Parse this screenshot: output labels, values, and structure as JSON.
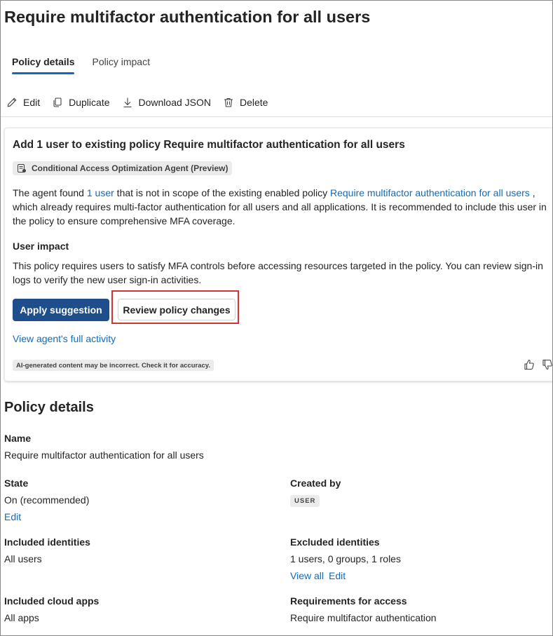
{
  "page": {
    "title": "Require multifactor authentication for all users"
  },
  "tabs": [
    {
      "label": "Policy details",
      "active": true
    },
    {
      "label": "Policy impact",
      "active": false
    }
  ],
  "toolbar": {
    "edit_label": "Edit",
    "duplicate_label": "Duplicate",
    "download_label": "Download JSON",
    "delete_label": "Delete"
  },
  "suggestion": {
    "title": "Add 1 user to existing policy Require multifactor authentication for all users",
    "agent_badge": "Conditional Access Optimization Agent (Preview)",
    "desc_part1": "The agent found ",
    "desc_link1": "1 user",
    "desc_part2": " that is not in scope of the existing enabled policy ",
    "desc_link2": "Require multifactor authentication for all users",
    "desc_part3": " , which already requires multi-factor authentication for all users and all applications. It is recommended to include this user in the policy to ensure comprehensive MFA coverage.",
    "impact_heading": "User impact",
    "impact_text": "This policy requires users to satisfy MFA controls before accessing resources targeted in the policy. You can review sign-in logs to verify the new user sign-in activities.",
    "apply_label": "Apply suggestion",
    "review_label": "Review policy changes",
    "activity_link": "View agent's full activity",
    "ai_note": "AI-generated content may be incorrect. Check it for accuracy."
  },
  "details": {
    "section_title": "Policy details",
    "name_label": "Name",
    "name_value": "Require multifactor authentication for all users",
    "state_label": "State",
    "state_value": "On (recommended)",
    "state_edit": "Edit",
    "created_by_label": "Created by",
    "created_by_value": "USER",
    "included_identities_label": "Included identities",
    "included_identities_value": "All users",
    "excluded_identities_label": "Excluded identities",
    "excluded_identities_value": "1 users, 0 groups, 1 roles",
    "view_all": "View all",
    "excluded_edit": "Edit",
    "included_apps_label": "Included cloud apps",
    "included_apps_value": "All apps",
    "requirements_label": "Requirements for access",
    "requirements_value": "Require multifactor authentication"
  },
  "colors": {
    "accent": "#0f6cbd",
    "primary_button": "#1f4e8c",
    "highlight": "#d13438"
  }
}
